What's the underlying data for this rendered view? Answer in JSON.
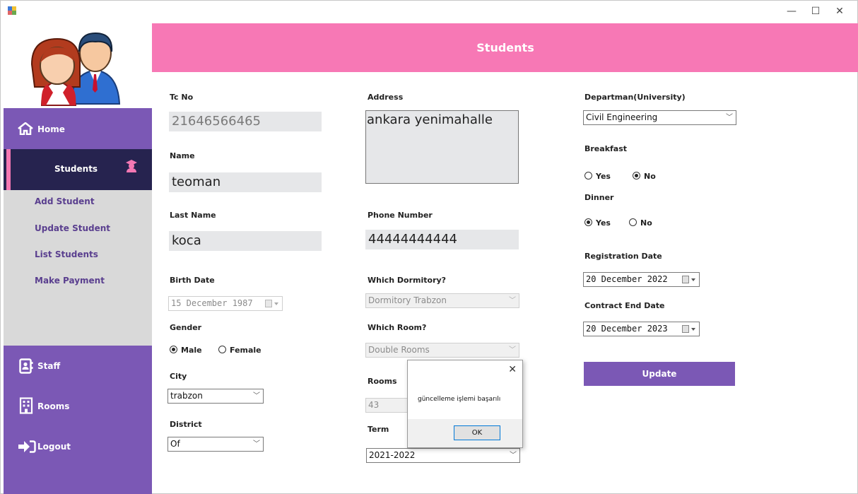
{
  "window": {
    "minimize_glyph": "—",
    "maximize_glyph": "☐",
    "close_glyph": "✕"
  },
  "sidebar": {
    "home_label": "Home",
    "students_label": "Students",
    "submenu": [
      "Add Student",
      "Update Student",
      "List Students",
      "Make Payment"
    ],
    "staff_label": "Staff",
    "rooms_label": "Rooms",
    "logout_label": "Logout"
  },
  "header": {
    "title": "Students"
  },
  "form": {
    "tcno": {
      "label": "Tc No",
      "value": "21646566465"
    },
    "name": {
      "label": "Name",
      "value": "teoman"
    },
    "lastname": {
      "label": "Last Name",
      "value": "koca"
    },
    "birthdate": {
      "label": "Birth Date",
      "value": "15 December 1987"
    },
    "gender": {
      "label": "Gender",
      "options": [
        "Male",
        "Female"
      ],
      "selected": "Male"
    },
    "city": {
      "label": "City",
      "value": "trabzon"
    },
    "district": {
      "label": "District",
      "value": "Of"
    },
    "address": {
      "label": "Address",
      "value": "ankara yenimahalle"
    },
    "phone": {
      "label": "Phone Number",
      "value": "44444444444"
    },
    "dormitory": {
      "label": "Which Dormitory?",
      "value": "Dormitory Trabzon"
    },
    "room_type": {
      "label": "Which Room?",
      "value": "Double Rooms"
    },
    "rooms": {
      "label": "Rooms",
      "value": "43"
    },
    "term": {
      "label": "Term",
      "value": "2021-2022"
    },
    "department": {
      "label": "Departman(University)",
      "value": "Civil Engineering"
    },
    "breakfast": {
      "label": "Breakfast",
      "options": [
        "Yes",
        "No"
      ],
      "selected": "No"
    },
    "dinner": {
      "label": "Dinner",
      "options": [
        "Yes",
        "No"
      ],
      "selected": "Yes"
    },
    "registration": {
      "label": "Registration Date",
      "value": "20 December 2022"
    },
    "contract_end": {
      "label": "Contract End Date",
      "value": "20 December 2023"
    },
    "update_label": "Update"
  },
  "dialog": {
    "message": "güncelleme işlemi başarılı",
    "ok_label": "OK"
  },
  "colors": {
    "accent_purple": "#7b58b5",
    "header_pink": "#f778b5",
    "nav_dark": "#26234f"
  }
}
